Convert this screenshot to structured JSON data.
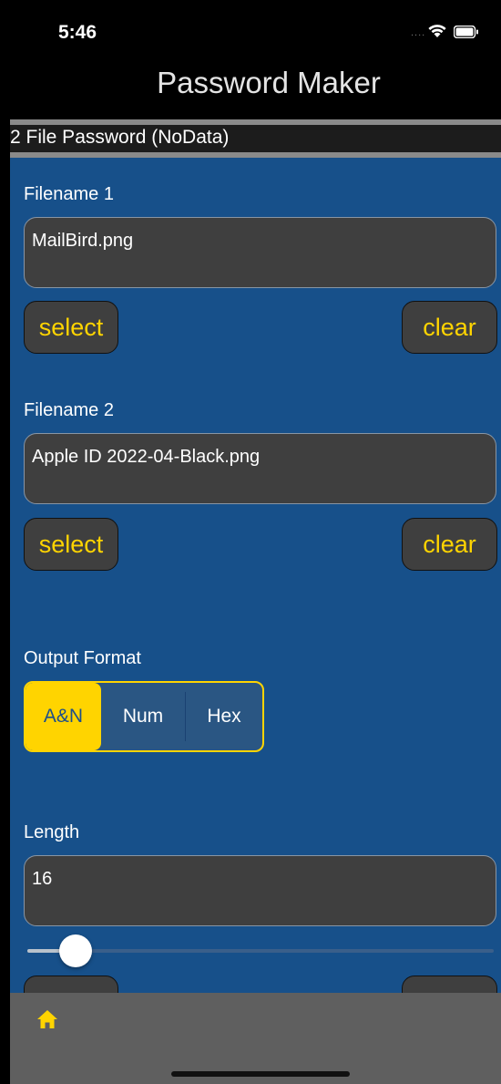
{
  "status": {
    "time": "5:46",
    "dots": "...."
  },
  "nav": {
    "title": "Password Maker"
  },
  "header": {
    "title": "2 File Password (NoData)"
  },
  "file1": {
    "label": "Filename 1",
    "value": "MailBird.png",
    "select_label": "select",
    "clear_label": "clear"
  },
  "file2": {
    "label": "Filename 2",
    "value": "Apple ID 2022-04-Black.png",
    "select_label": "select",
    "clear_label": "clear"
  },
  "output_format": {
    "label": "Output Format",
    "options": [
      "A&N",
      "Num",
      "Hex"
    ],
    "selected": "A&N"
  },
  "length": {
    "label": "Length",
    "value": "16",
    "slider_fraction": 0.06
  },
  "tab_bar": {
    "items": [
      {
        "icon": "home-icon"
      }
    ]
  },
  "colors": {
    "accent": "#ffd400",
    "content_bg": "#17508a",
    "field_bg": "#3f3f3f"
  }
}
